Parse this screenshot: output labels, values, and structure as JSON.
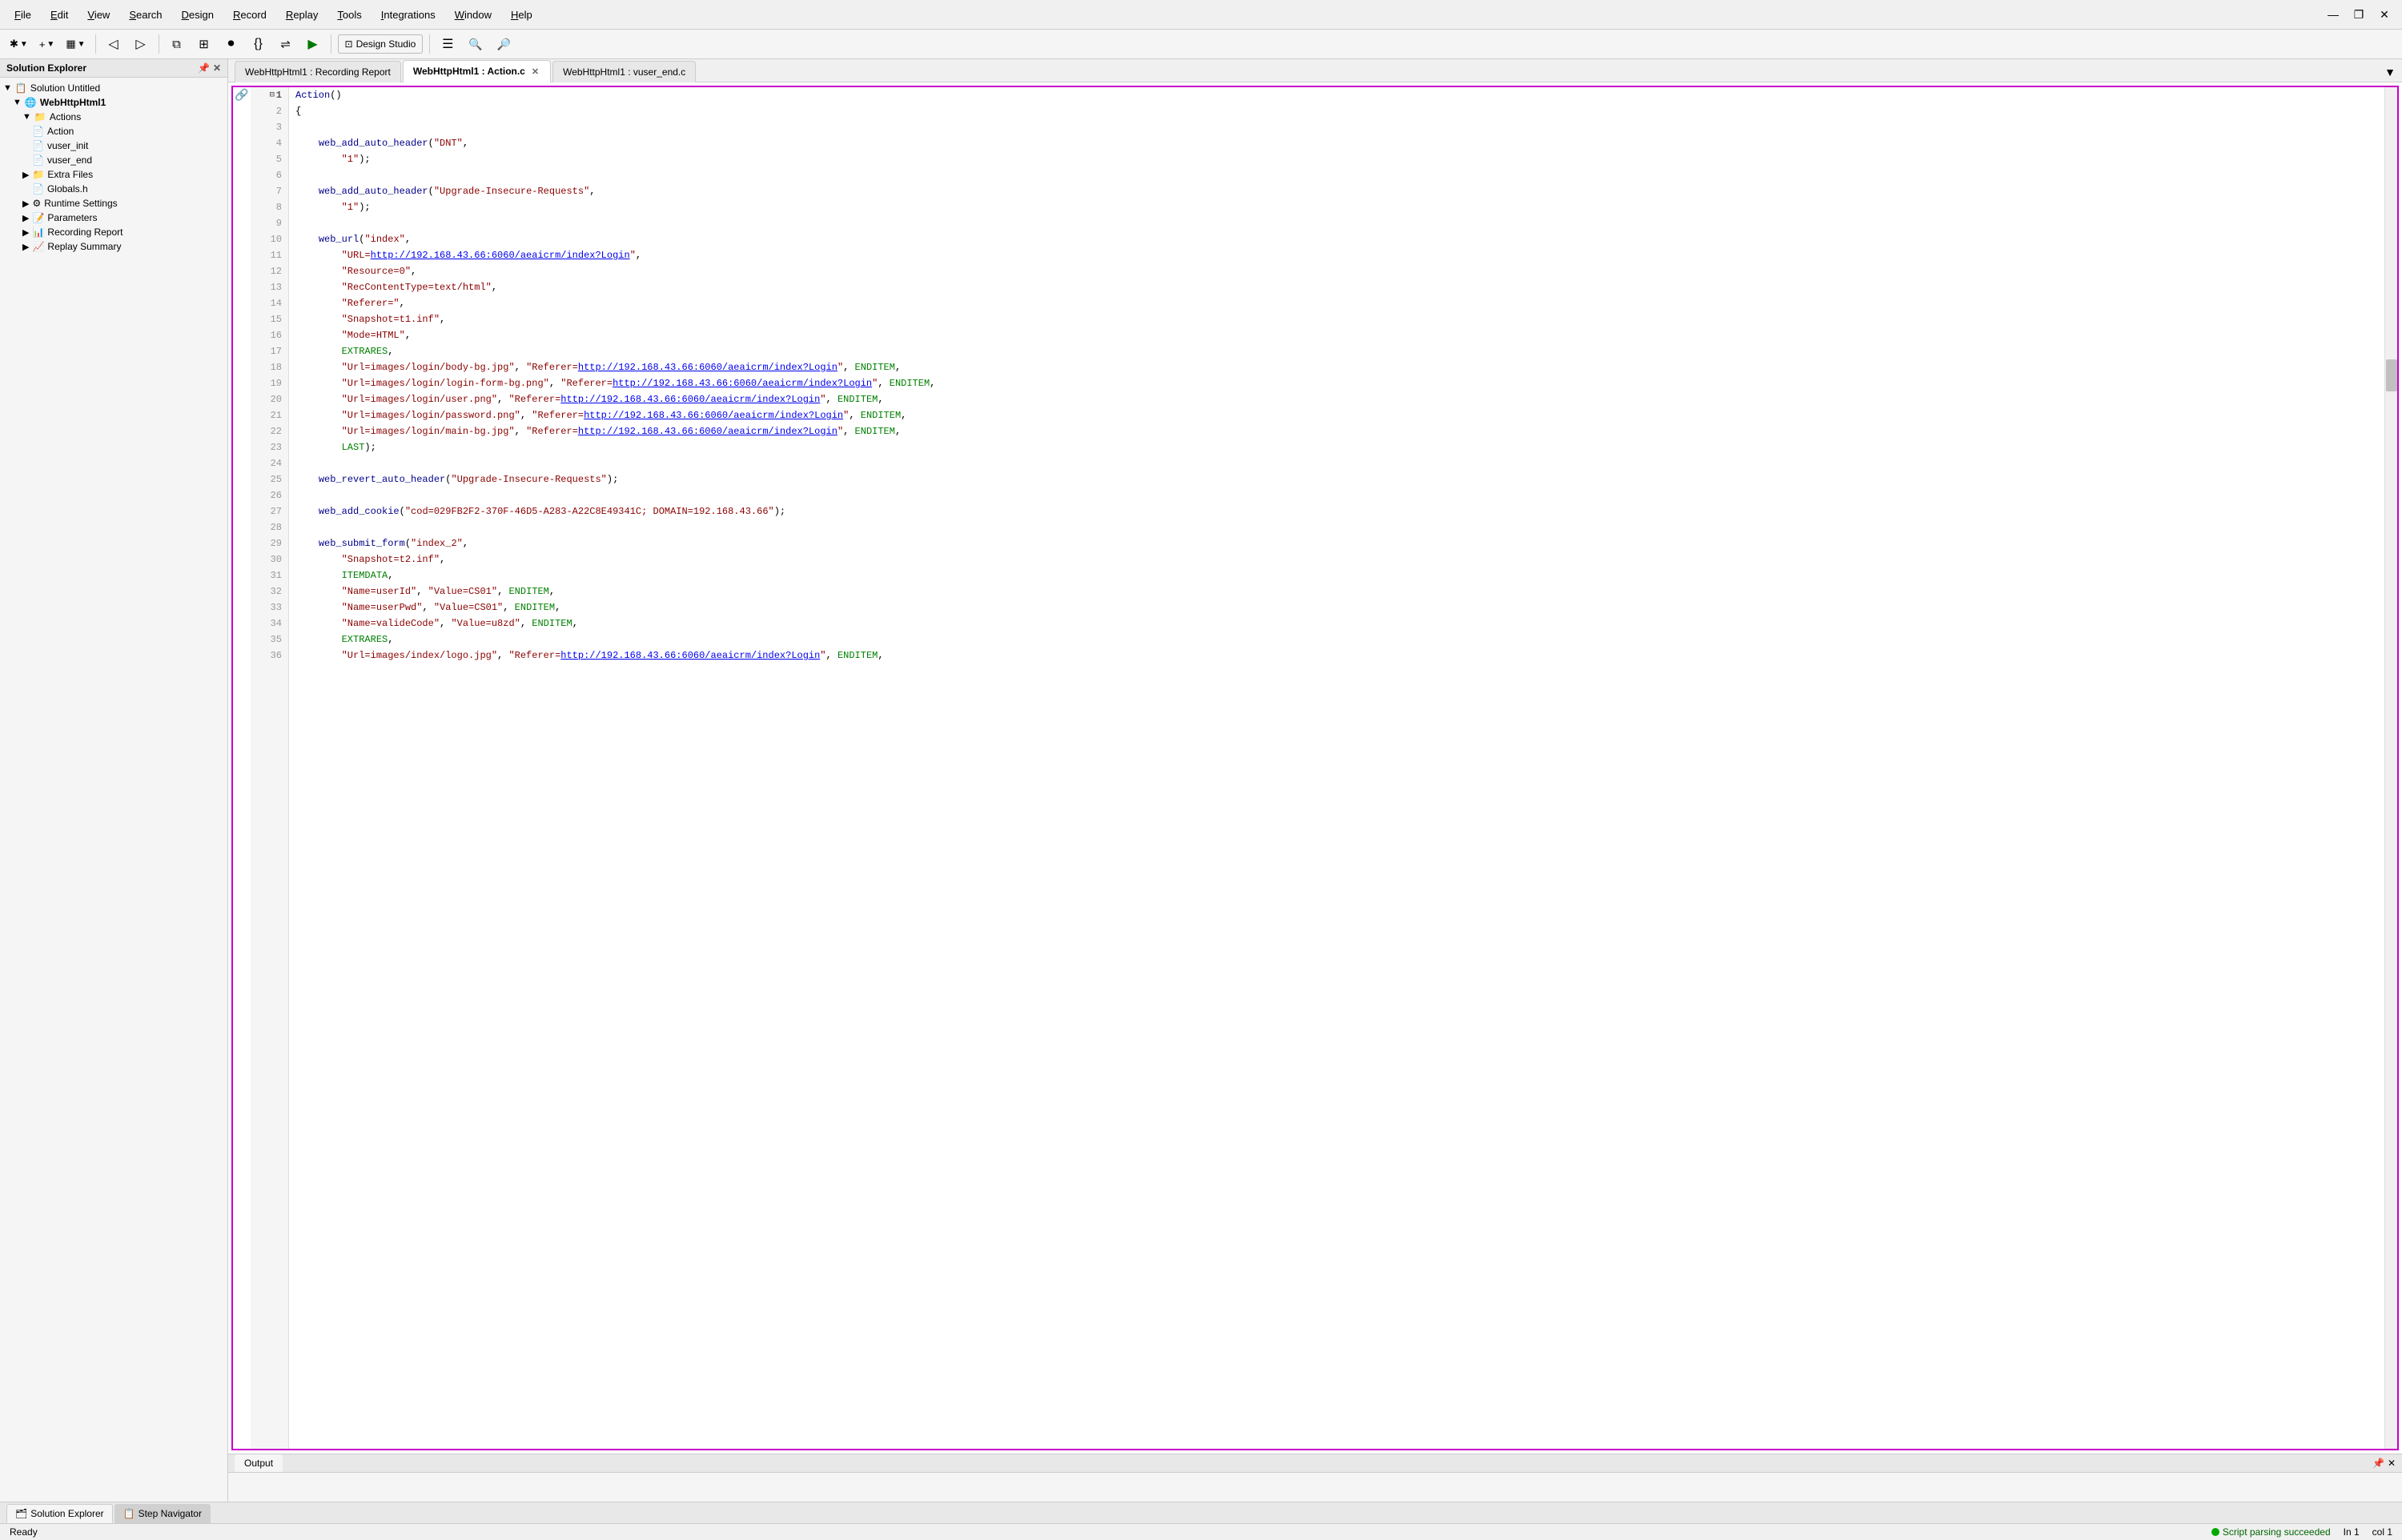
{
  "menubar": {
    "items": [
      {
        "label": "File",
        "underline": "F",
        "id": "file"
      },
      {
        "label": "Edit",
        "underline": "E",
        "id": "edit"
      },
      {
        "label": "View",
        "underline": "V",
        "id": "view"
      },
      {
        "label": "Search",
        "underline": "S",
        "id": "search"
      },
      {
        "label": "Design",
        "underline": "D",
        "id": "design"
      },
      {
        "label": "Record",
        "underline": "R",
        "id": "record"
      },
      {
        "label": "Replay",
        "underline": "R",
        "id": "replay"
      },
      {
        "label": "Tools",
        "underline": "T",
        "id": "tools"
      },
      {
        "label": "Integrations",
        "underline": "I",
        "id": "integrations"
      },
      {
        "label": "Window",
        "underline": "W",
        "id": "window"
      },
      {
        "label": "Help",
        "underline": "H",
        "id": "help"
      }
    ],
    "window_controls": [
      "—",
      "❐",
      "✕"
    ]
  },
  "toolbar": {
    "design_studio_label": "Design Studio"
  },
  "solution_explorer": {
    "title": "Solution Explorer",
    "tree": [
      {
        "label": "Solution Untitled",
        "level": 0,
        "icon": "📋"
      },
      {
        "label": "WebHttpHtml1",
        "level": 1,
        "icon": "🌐"
      },
      {
        "label": "Actions",
        "level": 2,
        "icon": "📁"
      },
      {
        "label": "Action",
        "level": 3,
        "icon": "📄"
      },
      {
        "label": "vuser_init",
        "level": 3,
        "icon": "📄"
      },
      {
        "label": "vuser_end",
        "level": 3,
        "icon": "📄"
      },
      {
        "label": "Extra Files",
        "level": 2,
        "icon": "📁"
      },
      {
        "label": "Globals.h",
        "level": 3,
        "icon": "📄"
      },
      {
        "label": "Runtime Settings",
        "level": 2,
        "icon": "⚙"
      },
      {
        "label": "Parameters",
        "level": 2,
        "icon": "📝"
      },
      {
        "label": "Recording Report",
        "level": 2,
        "icon": "📊"
      },
      {
        "label": "Replay Summary",
        "level": 2,
        "icon": "📈"
      }
    ]
  },
  "tabs": [
    {
      "label": "WebHttpHtml1 : Recording Report",
      "active": false,
      "closable": false
    },
    {
      "label": "WebHttpHtml1 : Action.c",
      "active": true,
      "closable": true
    },
    {
      "label": "WebHttpHtml1 : vuser_end.c",
      "active": false,
      "closable": false
    }
  ],
  "code": {
    "lines": [
      {
        "num": 1,
        "content": "Action()",
        "fold": "⊟"
      },
      {
        "num": 2,
        "content": "{"
      },
      {
        "num": 3,
        "content": ""
      },
      {
        "num": 4,
        "content": "    web_add_auto_header(\"DNT\","
      },
      {
        "num": 5,
        "content": "        \"1\");"
      },
      {
        "num": 6,
        "content": ""
      },
      {
        "num": 7,
        "content": "    web_add_auto_header(\"Upgrade-Insecure-Requests\","
      },
      {
        "num": 8,
        "content": "        \"1\");"
      },
      {
        "num": 9,
        "content": ""
      },
      {
        "num": 10,
        "content": "    web_url(\"index\","
      },
      {
        "num": 11,
        "content": "        \"URL=http://192.168.43.66:6060/aeaicrm/index?Login\","
      },
      {
        "num": 12,
        "content": "        \"Resource=0\","
      },
      {
        "num": 13,
        "content": "        \"RecContentType=text/html\","
      },
      {
        "num": 14,
        "content": "        \"Referer=\","
      },
      {
        "num": 15,
        "content": "        \"Snapshot=t1.inf\","
      },
      {
        "num": 16,
        "content": "        \"Mode=HTML\","
      },
      {
        "num": 17,
        "content": "        EXTRARES,"
      },
      {
        "num": 18,
        "content": "        \"Url=images/login/body-bg.jpg\", \"Referer=http://192.168.43.66:6060/aeaicrm/index?Login\", ENDITEM,"
      },
      {
        "num": 19,
        "content": "        \"Url=images/login/login-form-bg.png\", \"Referer=http://192.168.43.66:6060/aeaicrm/index?Login\", ENDITEM,"
      },
      {
        "num": 20,
        "content": "        \"Url=images/login/user.png\", \"Referer=http://192.168.43.66:6060/aeaicrm/index?Login\", ENDITEM,"
      },
      {
        "num": 21,
        "content": "        \"Url=images/login/password.png\", \"Referer=http://192.168.43.66:6060/aeaicrm/index?Login\", ENDITEM,"
      },
      {
        "num": 22,
        "content": "        \"Url=images/login/main-bg.jpg\", \"Referer=http://192.168.43.66:6060/aeaicrm/index?Login\", ENDITEM,"
      },
      {
        "num": 23,
        "content": "        LAST);"
      },
      {
        "num": 24,
        "content": ""
      },
      {
        "num": 25,
        "content": "    web_revert_auto_header(\"Upgrade-Insecure-Requests\");"
      },
      {
        "num": 26,
        "content": ""
      },
      {
        "num": 27,
        "content": "    web_add_cookie(\"cod=029FB2F2-370F-46D5-A283-A22C8E49341C; DOMAIN=192.168.43.66\");"
      },
      {
        "num": 28,
        "content": ""
      },
      {
        "num": 29,
        "content": "    web_submit_form(\"index_2\","
      },
      {
        "num": 30,
        "content": "        \"Snapshot=t2.inf\","
      },
      {
        "num": 31,
        "content": "        ITEMDATA,"
      },
      {
        "num": 32,
        "content": "        \"Name=userId\", \"Value=CS01\", ENDITEM,"
      },
      {
        "num": 33,
        "content": "        \"Name=userPwd\", \"Value=CS01\", ENDITEM,"
      },
      {
        "num": 34,
        "content": "        \"Name=valideCode\", \"Value=u8zd\", ENDITEM,"
      },
      {
        "num": 35,
        "content": "        EXTRARES,"
      },
      {
        "num": 36,
        "content": "        \"Url=images/index/logo.jpg\", \"Referer=http://192.168.43.66:6060/aeaicrm/index?Login\", ENDITEM,"
      }
    ]
  },
  "bottom": {
    "tab_label": "Output",
    "content": ""
  },
  "nav_tabs": [
    {
      "label": "Solution Explorer",
      "icon": "🗂",
      "active": true
    },
    {
      "label": "Step Navigator",
      "icon": "📋",
      "active": false
    }
  ],
  "status": {
    "ready": "Ready",
    "script_status": "Script parsing succeeded",
    "ln": "In 1",
    "col": "col 1"
  }
}
